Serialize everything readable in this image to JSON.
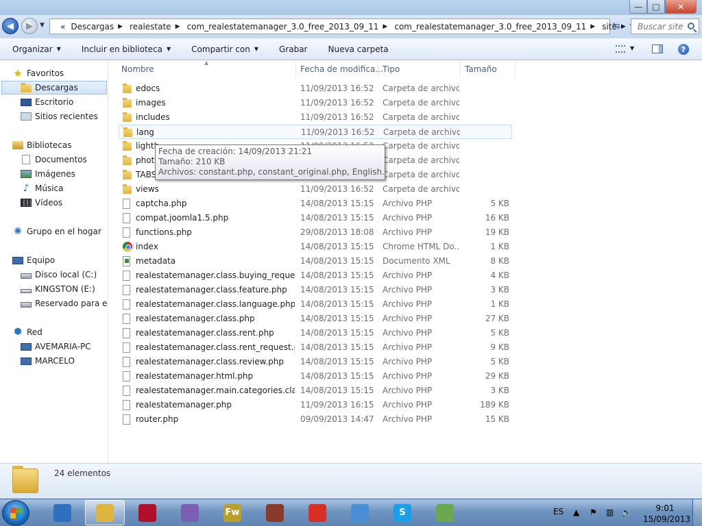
{
  "window": {
    "controls": {
      "minimize": "—",
      "maximize": "□",
      "close": "✕"
    }
  },
  "address": {
    "overflow": "«",
    "crumbs": [
      "Descargas",
      "realestate",
      "com_realestatemanager_3.0_free_2013_09_11",
      "com_realestatemanager_3.0_free_2013_09_11",
      "site"
    ],
    "search_placeholder": "Buscar site"
  },
  "toolbar": {
    "organize": "Organizar",
    "include": "Incluir en biblioteca",
    "share": "Compartir con",
    "burn": "Grabar",
    "new_folder": "Nueva carpeta"
  },
  "nav": {
    "favorites": "Favoritos",
    "downloads": "Descargas",
    "desktop": "Escritorio",
    "recent": "Sitios recientes",
    "libraries": "Bibliotecas",
    "documents": "Documentos",
    "images": "Imágenes",
    "music": "Música",
    "videos": "Vídeos",
    "homegroup": "Grupo en el hogar",
    "computer": "Equipo",
    "disk_c": "Disco local (C:)",
    "kingston": "KINGSTON (E:)",
    "reserved": "Reservado para el sistema",
    "network": "Red",
    "pc1": "AVEMARIA-PC",
    "pc2": "MARCELO"
  },
  "columns": {
    "name": "Nombre",
    "date": "Fecha de modifica...",
    "type": "Tipo",
    "size": "Tamaño"
  },
  "files": [
    {
      "name": "edocs",
      "date": "11/09/2013 16:52",
      "type": "Carpeta de archivos",
      "size": "",
      "icon": "folder"
    },
    {
      "name": "images",
      "date": "11/09/2013 16:52",
      "type": "Carpeta de archivos",
      "size": "",
      "icon": "folder"
    },
    {
      "name": "includes",
      "date": "11/09/2013 16:52",
      "type": "Carpeta de archivos",
      "size": "",
      "icon": "folder"
    },
    {
      "name": "lang",
      "date": "11/09/2013 16:52",
      "type": "Carpeta de archivos",
      "size": "",
      "icon": "folder"
    },
    {
      "name": "lightb",
      "date": "11/09/2013 16:52",
      "type": "Carpeta de archivos",
      "size": "",
      "icon": "folder"
    },
    {
      "name": "phot",
      "date": "11/09/2013 16:52",
      "type": "Carpeta de archivos",
      "size": "",
      "icon": "folder"
    },
    {
      "name": "TABS",
      "date": "11/09/2013 16:52",
      "type": "Carpeta de archivos",
      "size": "",
      "icon": "folder"
    },
    {
      "name": "views",
      "date": "11/09/2013 16:52",
      "type": "Carpeta de archivos",
      "size": "",
      "icon": "folder"
    },
    {
      "name": "captcha.php",
      "date": "14/08/2013 15:15",
      "type": "Archivo PHP",
      "size": "5 KB",
      "icon": "file"
    },
    {
      "name": "compat.joomla1.5.php",
      "date": "14/08/2013 15:15",
      "type": "Archivo PHP",
      "size": "16 KB",
      "icon": "file"
    },
    {
      "name": "functions.php",
      "date": "29/08/2013 18:08",
      "type": "Archivo PHP",
      "size": "19 KB",
      "icon": "file"
    },
    {
      "name": "index",
      "date": "14/08/2013 15:15",
      "type": "Chrome HTML Do...",
      "size": "1 KB",
      "icon": "chrome"
    },
    {
      "name": "metadata",
      "date": "14/08/2013 15:15",
      "type": "Documento XML",
      "size": "8 KB",
      "icon": "xml"
    },
    {
      "name": "realestatemanager.class.buying_request....",
      "date": "14/08/2013 15:15",
      "type": "Archivo PHP",
      "size": "4 KB",
      "icon": "file"
    },
    {
      "name": "realestatemanager.class.feature.php",
      "date": "14/08/2013 15:15",
      "type": "Archivo PHP",
      "size": "3 KB",
      "icon": "file"
    },
    {
      "name": "realestatemanager.class.language.php",
      "date": "14/08/2013 15:15",
      "type": "Archivo PHP",
      "size": "1 KB",
      "icon": "file"
    },
    {
      "name": "realestatemanager.class.php",
      "date": "14/08/2013 15:15",
      "type": "Archivo PHP",
      "size": "27 KB",
      "icon": "file"
    },
    {
      "name": "realestatemanager.class.rent.php",
      "date": "14/08/2013 15:15",
      "type": "Archivo PHP",
      "size": "5 KB",
      "icon": "file"
    },
    {
      "name": "realestatemanager.class.rent_request.php",
      "date": "14/08/2013 15:15",
      "type": "Archivo PHP",
      "size": "9 KB",
      "icon": "file"
    },
    {
      "name": "realestatemanager.class.review.php",
      "date": "14/08/2013 15:15",
      "type": "Archivo PHP",
      "size": "5 KB",
      "icon": "file"
    },
    {
      "name": "realestatemanager.html.php",
      "date": "14/08/2013 15:15",
      "type": "Archivo PHP",
      "size": "29 KB",
      "icon": "file"
    },
    {
      "name": "realestatemanager.main.categories.class....",
      "date": "14/08/2013 15:15",
      "type": "Archivo PHP",
      "size": "3 KB",
      "icon": "file"
    },
    {
      "name": "realestatemanager.php",
      "date": "11/09/2013 16:15",
      "type": "Archivo PHP",
      "size": "189 KB",
      "icon": "file"
    },
    {
      "name": "router.php",
      "date": "09/09/2013 14:47",
      "type": "Archivo PHP",
      "size": "15 KB",
      "icon": "file"
    }
  ],
  "tooltip": {
    "line1": "Fecha de creación: 14/09/2013 21:21",
    "line2": "Tamaño: 210 KB",
    "line3": "Archivos: constant.php, constant_original.php, English.php, ..."
  },
  "details": {
    "count": "24 elementos"
  },
  "taskbar": {
    "lang": "ES",
    "time": "9:01",
    "date": "15/09/2013",
    "apps": [
      {
        "name": "media-player",
        "label": "",
        "color": "#2f6fc2"
      },
      {
        "name": "explorer",
        "label": "",
        "color": "#e0b442"
      },
      {
        "name": "app-red",
        "label": "",
        "color": "#b0102a"
      },
      {
        "name": "photo-app",
        "label": "",
        "color": "#7a5fb5"
      },
      {
        "name": "fireworks",
        "label": "Fw",
        "color": "#b9a02a"
      },
      {
        "name": "winrar",
        "label": "",
        "color": "#8a3a2a"
      },
      {
        "name": "chrome",
        "label": "",
        "color": "#d93025"
      },
      {
        "name": "paint",
        "label": "",
        "color": "#4b8ed8"
      },
      {
        "name": "skype",
        "label": "S",
        "color": "#1aa0e6"
      },
      {
        "name": "notepad-plus",
        "label": "",
        "color": "#6aa84f"
      }
    ]
  }
}
